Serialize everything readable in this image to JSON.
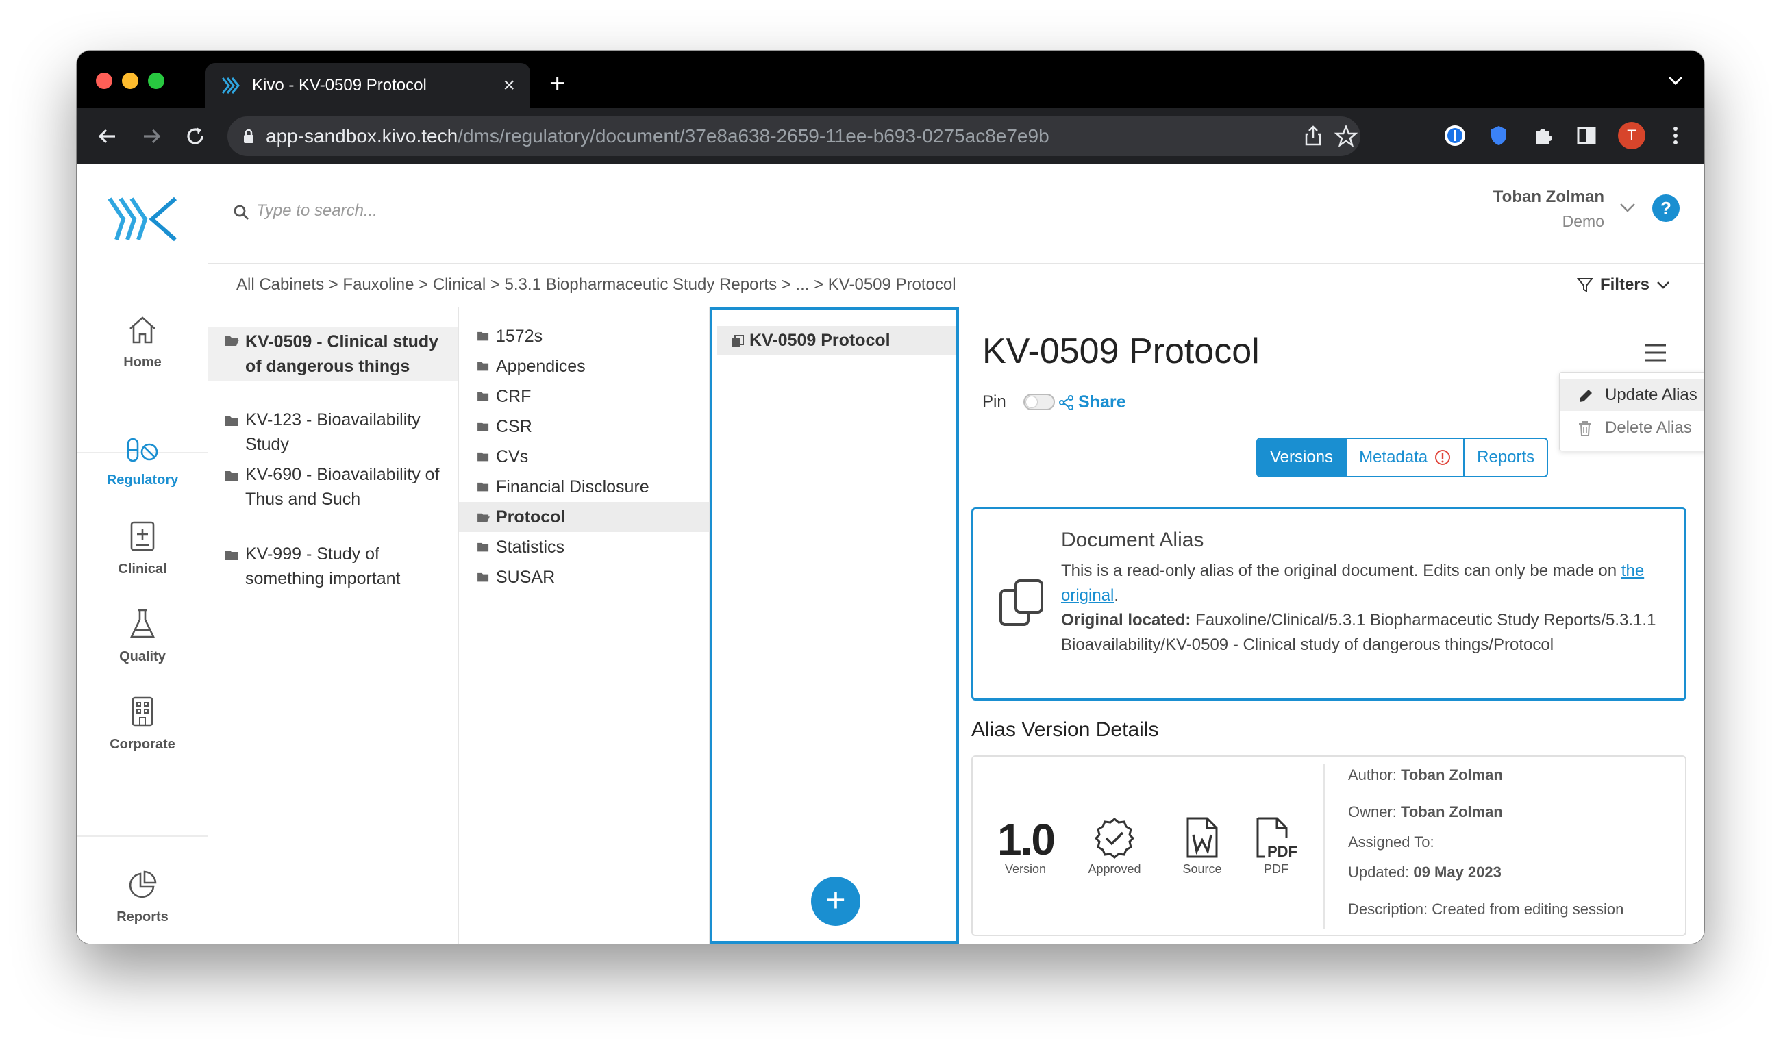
{
  "browser": {
    "tab_title": "Kivo - KV-0509 Protocol",
    "url_host": "app-sandbox.kivo.tech",
    "url_path": "/dms/regulatory/document/37e8a638-2659-11ee-b693-0275ac8e7e9b",
    "profile_initial": "T"
  },
  "search": {
    "placeholder": "Type to search..."
  },
  "user": {
    "name": "Toban Zolman",
    "role": "Demo",
    "help": "?"
  },
  "sidebar": {
    "home": "Home",
    "regulatory": "Regulatory",
    "clinical": "Clinical",
    "quality": "Quality",
    "corporate": "Corporate",
    "reports": "Reports"
  },
  "breadcrumb": "All Cabinets > Fauxoline > Clinical > 5.3.1 Biopharmaceutic Study Reports > ... > KV-0509 Protocol",
  "filters_label": "Filters",
  "column1": [
    "KV-0509 - Clinical study of dangerous things",
    "KV-123 - Bioavailability Study",
    "KV-690 - Bioavailability of Thus and Such",
    "KV-999 - Study of something important"
  ],
  "column2": [
    "1572s",
    "Appendices",
    "CRF",
    "CSR",
    "CVs",
    "Financial Disclosure",
    "Protocol",
    "Statistics",
    "SUSAR"
  ],
  "column3": {
    "doc": "KV-0509 Protocol",
    "add": "+"
  },
  "detail": {
    "title": "KV-0509 Protocol",
    "pin_label": "Pin",
    "share_label": "Share",
    "menu": {
      "update": "Update Alias",
      "delete": "Delete Alias"
    },
    "tabs": {
      "versions": "Versions",
      "metadata": "Metadata",
      "reports": "Reports"
    },
    "alias": {
      "title": "Document Alias",
      "text": "This is a read-only alias of the original document. Edits can only be made on",
      "link": "the original",
      "period": ".",
      "located_label": "Original located:",
      "located_value": "Fauxoline/Clinical/5.3.1 Biopharmaceutic Study Reports/5.3.1.1 Bioavailability/KV-0509 - Clinical study of dangerous things/Protocol"
    },
    "version_section_title": "Alias Version Details",
    "version": {
      "number": "1.0",
      "version_caption": "Version",
      "approved_caption": "Approved",
      "source_caption": "Source",
      "pdf_caption": "PDF",
      "author_label": "Author:",
      "author": "Toban Zolman",
      "owner_label": "Owner:",
      "owner": "Toban Zolman",
      "assigned_label": "Assigned To:",
      "updated_label": "Updated:",
      "updated": "09 May 2023",
      "description_label": "Description:",
      "description": "Created from editing session"
    }
  },
  "colors": {
    "accent": "#1a8fd1",
    "chrome": "#202124"
  }
}
